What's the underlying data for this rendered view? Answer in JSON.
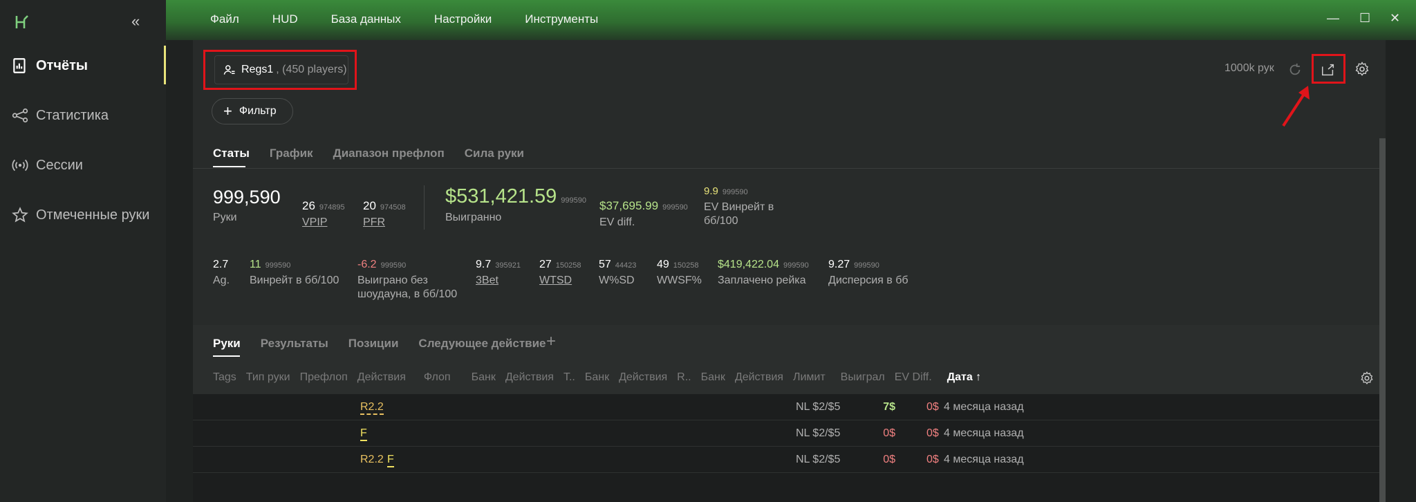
{
  "sidebar": {
    "items": [
      {
        "label": "Отчёты",
        "icon": "report-icon"
      },
      {
        "label": "Статистика",
        "icon": "share-icon"
      },
      {
        "label": "Сессии",
        "icon": "broadcast-icon"
      },
      {
        "label": "Отмеченные руки",
        "icon": "star-icon"
      }
    ],
    "collapse": "«"
  },
  "menu": [
    "Файл",
    "HUD",
    "База данных",
    "Настройки",
    "Инструменты"
  ],
  "window": {
    "minimize": "—",
    "maximize": "☐",
    "close": "✕"
  },
  "filter": {
    "name": "Regs1",
    "players": ", (450 players)"
  },
  "add_filter": {
    "plus": "+",
    "label": "Фильтр"
  },
  "hands_count": "1000k рук",
  "tabs": [
    "Статы",
    "График",
    "Диапазон префлоп",
    "Сила руки"
  ],
  "stats_top": {
    "hands": {
      "value": "999,590",
      "label": "Руки"
    },
    "vpip": {
      "value": "26",
      "sub": "974895",
      "label": "VPIP"
    },
    "pfr": {
      "value": "20",
      "sub": "974508",
      "label": "PFR"
    },
    "won": {
      "value": "$531,421.59",
      "sub": "999590",
      "label": "Выигранно"
    },
    "ev_diff": {
      "value": "$37,695.99",
      "sub": "999590",
      "label": "EV diff."
    },
    "ev_winrate": {
      "value": "9.9",
      "sub": "999590",
      "label1": "EV Винрейт в",
      "label2": "бб/100"
    }
  },
  "stats_bottom": {
    "ag": {
      "value": "2.7",
      "label": "Ag."
    },
    "winrate": {
      "value": "11",
      "sub": "999590",
      "label": "Винрейт в бб/100"
    },
    "nosd": {
      "value": "-6.2",
      "sub": "999590",
      "label1": "Выиграно без",
      "label2": "шоудауна, в бб/100"
    },
    "threebet": {
      "value": "9.7",
      "sub": "395921",
      "label": "3Bet"
    },
    "wtsd": {
      "value": "27",
      "sub": "150258",
      "label": "WTSD"
    },
    "wsd": {
      "value": "57",
      "sub": "44423",
      "label": "W%SD"
    },
    "wwsf": {
      "value": "49",
      "sub": "150258",
      "label": "WWSF%"
    },
    "rake": {
      "value": "$419,422.04",
      "sub": "999590",
      "label": "Заплачено рейка"
    },
    "variance": {
      "value": "9.27",
      "sub": "999590",
      "label": "Дисперсия в бб"
    }
  },
  "tabs2": [
    "Руки",
    "Результаты",
    "Позиции",
    "Следующее действие"
  ],
  "tabs2_plus": "+",
  "columns": [
    "Tags",
    "Тип руки",
    "Префлоп",
    "Действия",
    "Флоп",
    "Банк",
    "Действия",
    "T..",
    "Банк",
    "Действия",
    "R..",
    "Банк",
    "Действия",
    "Лимит",
    "Выиграл",
    "EV Diff.",
    "Дата ↑"
  ],
  "rows": [
    {
      "preflop": "R2.2",
      "flop": "",
      "limit": "NL $2/$5",
      "won": "7$",
      "ev": "0$",
      "date": "4 месяца назад"
    },
    {
      "preflop": "",
      "flop": "F",
      "limit": "NL $2/$5",
      "won": "0$",
      "ev": "0$",
      "date": "4 месяца назад"
    },
    {
      "preflop": "R2.2",
      "flop": "F",
      "limit": "NL $2/$5",
      "won": "0$",
      "ev": "0$",
      "date": "4 месяца назад"
    }
  ],
  "colors": {
    "accent": "#e8e37a",
    "positive": "#b6e38a",
    "negative": "#f08080",
    "highlight": "#e0141a"
  }
}
